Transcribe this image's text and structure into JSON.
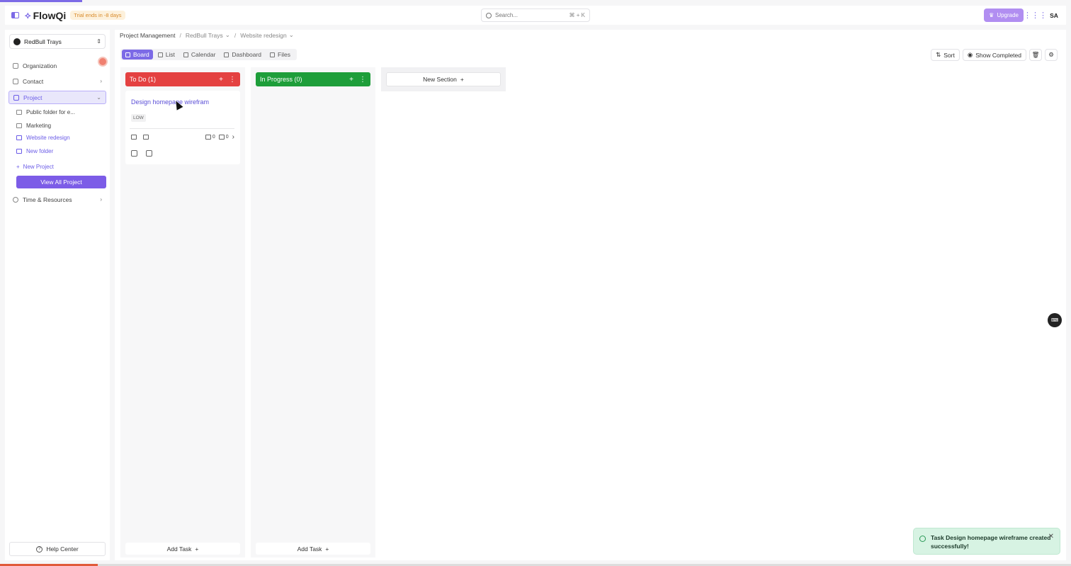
{
  "header": {
    "app_name": "FlowQi",
    "trial_text": "Trial ends in -8 days",
    "search_placeholder": "Search...",
    "search_shortcut": "⌘ + K",
    "upgrade_label": "Upgrade",
    "avatar_initials": "SA"
  },
  "sidebar": {
    "workspace_name": "RedBull Trays",
    "items": [
      {
        "label": "Organization"
      },
      {
        "label": "Contact"
      },
      {
        "label": "Project"
      },
      {
        "label": "Time & Resources"
      }
    ],
    "project_children": [
      {
        "label": "Public folder for e..."
      },
      {
        "label": "Marketing"
      },
      {
        "label": "Website redesign"
      },
      {
        "label": "New folder"
      }
    ],
    "new_project_label": "New Project",
    "view_all_label": "View All Project",
    "help_label": "Help Center"
  },
  "breadcrumb": {
    "root": "Project Management",
    "workspace": "RedBull Trays",
    "project": "Website redesign"
  },
  "view_tabs": [
    {
      "label": "Board"
    },
    {
      "label": "List"
    },
    {
      "label": "Calendar"
    },
    {
      "label": "Dashboard"
    },
    {
      "label": "Files"
    }
  ],
  "toolbar": {
    "sort_label": "Sort",
    "show_completed_label": "Show Completed"
  },
  "board": {
    "columns": [
      {
        "title": "To Do (1)",
        "color": "#e44141",
        "add_task_label": "Add Task",
        "cards": [
          {
            "title": "Design homepage wirefram",
            "priority": "LOW",
            "comments": "0",
            "subtasks": "0"
          }
        ]
      },
      {
        "title": "In Progress (0)",
        "color": "#1e9e3a",
        "add_task_label": "Add Task",
        "cards": []
      }
    ],
    "new_section_label": "New Section"
  },
  "toast": {
    "message": "Task Design homepage wireframe created successfully!",
    "color": "#d7f3e3"
  },
  "colors": {
    "accent": "#7c6ae6"
  }
}
